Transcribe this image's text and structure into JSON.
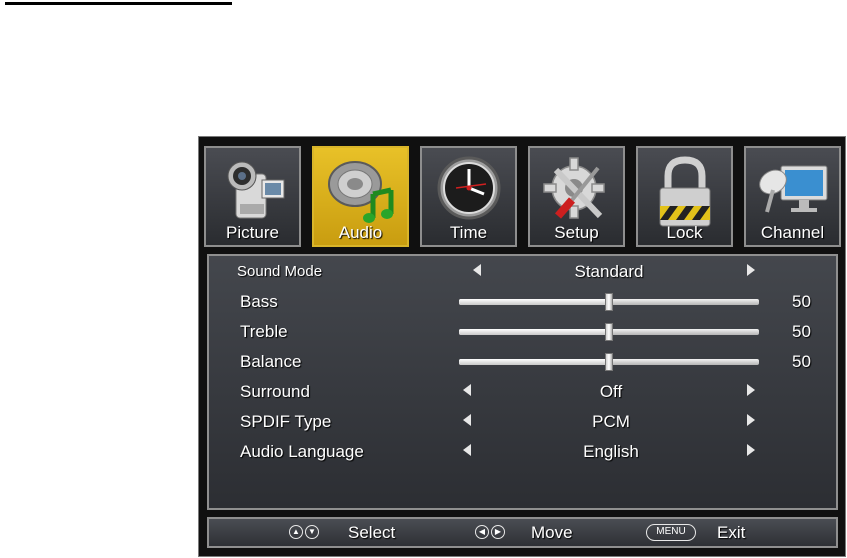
{
  "tabs": [
    {
      "label": "Picture",
      "icon": "camcorder-icon",
      "active": false
    },
    {
      "label": "Audio",
      "icon": "speaker-music-icon",
      "active": true
    },
    {
      "label": "Time",
      "icon": "clock-icon",
      "active": false
    },
    {
      "label": "Setup",
      "icon": "gear-tools-icon",
      "active": false
    },
    {
      "label": "Lock",
      "icon": "padlock-icon",
      "active": false
    },
    {
      "label": "Channel",
      "icon": "satellite-monitor-icon",
      "active": false
    }
  ],
  "audio": {
    "sound_mode": {
      "label": "Sound Mode",
      "value": "Standard"
    },
    "bass": {
      "label": "Bass",
      "value": "50",
      "level": 50
    },
    "treble": {
      "label": "Treble",
      "value": "50",
      "level": 50
    },
    "balance": {
      "label": "Balance",
      "value": "50",
      "level": 50
    },
    "surround": {
      "label": "Surround",
      "value": "Off"
    },
    "spdif_type": {
      "label": "SPDIF Type",
      "value": "PCM"
    },
    "audio_language": {
      "label": "Audio Language",
      "value": "English"
    }
  },
  "footer": {
    "select_label": "Select",
    "move_label": "Move",
    "menu_key": "MENU",
    "exit_label": "Exit"
  },
  "colors": {
    "active_tab": "#e0b820",
    "panel": "#3a3d42",
    "text": "#ffffff"
  }
}
